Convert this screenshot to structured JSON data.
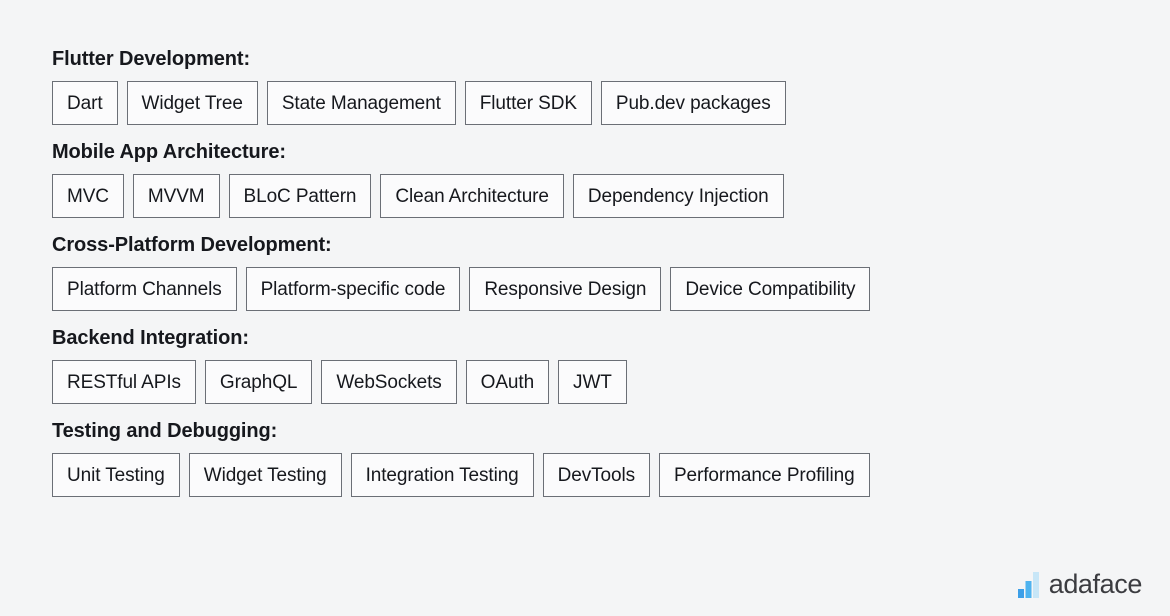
{
  "page": {
    "background_color": "#f4f5f6",
    "text_color": "#16181d",
    "tag_border_color": "#6b6f76",
    "tag_fill_color": "#fbfbfc"
  },
  "sections": [
    {
      "heading": "Flutter Development:",
      "tags": [
        "Dart",
        "Widget Tree",
        "State Management",
        "Flutter SDK",
        "Pub.dev packages"
      ]
    },
    {
      "heading": "Mobile App Architecture:",
      "tags": [
        "MVC",
        "MVVM",
        "BLoC Pattern",
        "Clean Architecture",
        "Dependency Injection"
      ]
    },
    {
      "heading": "Cross-Platform Development:",
      "tags": [
        "Platform Channels",
        "Platform-specific code",
        "Responsive Design",
        "Device Compatibility"
      ]
    },
    {
      "heading": "Backend Integration:",
      "tags": [
        "RESTful APIs",
        "GraphQL",
        "WebSockets",
        "OAuth",
        "JWT"
      ]
    },
    {
      "heading": "Testing and Debugging:",
      "tags": [
        "Unit Testing",
        "Widget Testing",
        "Integration Testing",
        "DevTools",
        "Performance Profiling"
      ]
    }
  ],
  "logo": {
    "icon": "bar-chart-icon",
    "text": "adaface",
    "text_color": "#3b3c40",
    "bar_colors": [
      "#3c9fe8",
      "#4eb3ef",
      "#c7e6f7"
    ]
  }
}
